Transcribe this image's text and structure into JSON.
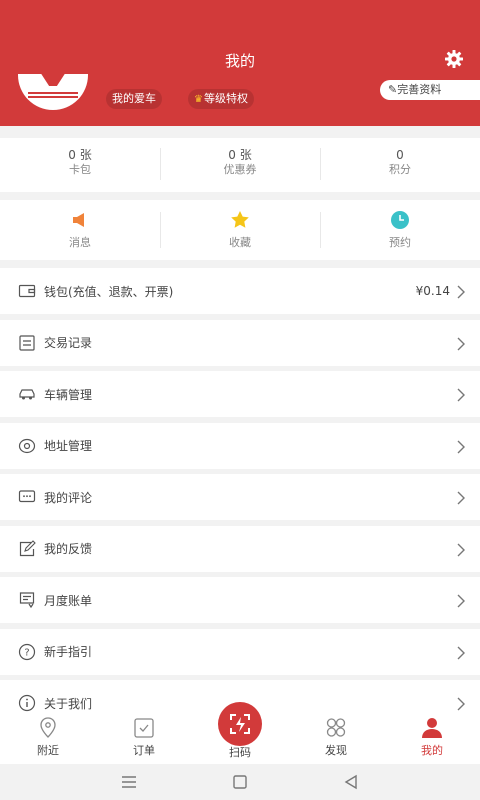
{
  "header": {
    "title": "我的",
    "settings_icon": "gear-icon",
    "tags": {
      "my_car": "我的爱车",
      "level": "等级特权"
    },
    "edit_profile": "完善资料",
    "bg_color": "#d23a3a"
  },
  "stats": [
    {
      "value": "0 张",
      "label": "卡包"
    },
    {
      "value": "0 张",
      "label": "优惠券"
    },
    {
      "value": "0",
      "label": "积分"
    }
  ],
  "quick": [
    {
      "label": "消息",
      "icon": "megaphone-icon",
      "color": "#f0833a"
    },
    {
      "label": "收藏",
      "icon": "star-icon",
      "color": "#f5c518"
    },
    {
      "label": "预约",
      "icon": "clock-icon",
      "color": "#3ac1c8"
    }
  ],
  "menu": [
    {
      "label": "钱包(充值、退款、开票)",
      "value": "¥0.14",
      "icon": "wallet-icon"
    },
    {
      "label": "交易记录",
      "icon": "transaction-record-icon"
    },
    {
      "label": "车辆管理",
      "icon": "car-icon"
    },
    {
      "label": "地址管理",
      "icon": "location-icon"
    },
    {
      "label": "我的评论",
      "icon": "comment-icon"
    },
    {
      "label": "我的反馈",
      "icon": "feedback-icon"
    },
    {
      "label": "月度账单",
      "icon": "bill-icon"
    },
    {
      "label": "新手指引",
      "icon": "question-icon"
    },
    {
      "label": "关于我们",
      "icon": "info-icon"
    }
  ],
  "tabs": [
    {
      "label": "附近",
      "icon": "location-pin-icon"
    },
    {
      "label": "订单",
      "icon": "order-icon"
    },
    {
      "label": "扫码",
      "icon": "scan-icon"
    },
    {
      "label": "发现",
      "icon": "discover-icon"
    },
    {
      "label": "我的",
      "icon": "user-icon"
    }
  ]
}
